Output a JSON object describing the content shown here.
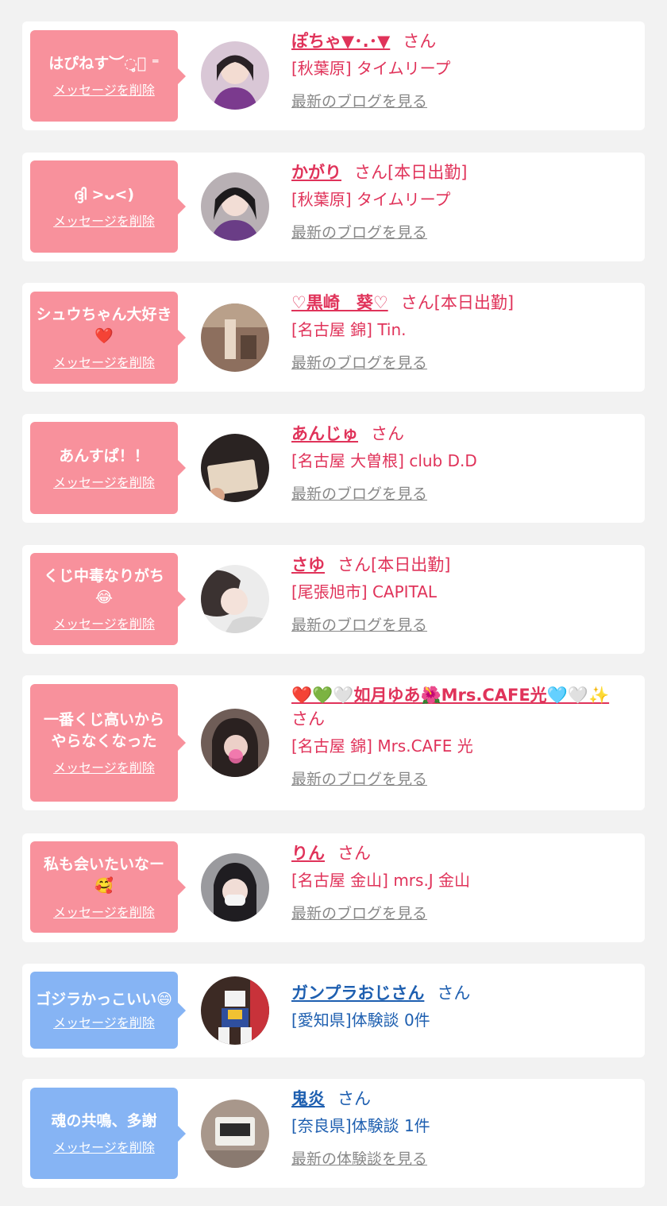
{
  "items": [
    {
      "message": "はぴねす︶◌̥̥̥⃝ ⁼",
      "delete_label": "メッセージを削除",
      "name": "ぽちゃ▼･.･▼",
      "san": "さん",
      "shop": "[秋葉原] タイムリープ",
      "latest": "最新のブログを見る",
      "theme": "pink"
    },
    {
      "message": "ദ്ദി >ᴗ<)",
      "delete_label": "メッセージを削除",
      "name": "かがり",
      "san": "さん[本日出勤]",
      "shop": "[秋葉原] タイムリープ",
      "latest": "最新のブログを見る",
      "theme": "pink"
    },
    {
      "message": "シュウちゃん大好き❤️",
      "delete_label": "メッセージを削除",
      "name": "♡黒崎　葵♡",
      "san": "さん[本日出勤]",
      "shop": "[名古屋 錦] Tin.",
      "latest": "最新のブログを見る",
      "theme": "pink"
    },
    {
      "message": "あんすぱ！！",
      "delete_label": "メッセージを削除",
      "name": "あんじゅ",
      "san": "さん",
      "shop": "[名古屋 大曽根] club D.D",
      "latest": "最新のブログを見る",
      "theme": "pink"
    },
    {
      "message": "くじ中毒なりがち😂",
      "delete_label": "メッセージを削除",
      "name": "さゆ",
      "san": "さん[本日出勤]",
      "shop": "[尾張旭市] CAPITAL",
      "latest": "最新のブログを見る",
      "theme": "pink"
    },
    {
      "message": "一番くじ高いからやらなくなった",
      "delete_label": "メッセージを削除",
      "name": "❤️💚🤍如月ゆあ🌺Mrs.CAFE光🩵🤍✨",
      "san": "さん",
      "shop": "[名古屋 錦] Mrs.CAFE 光",
      "latest": "最新のブログを見る",
      "theme": "pink"
    },
    {
      "message": "私も会いたいなー🥰",
      "delete_label": "メッセージを削除",
      "name": "りん",
      "san": "さん",
      "shop": "[名古屋 金山] mrs.J 金山",
      "latest": "最新のブログを見る",
      "theme": "pink"
    },
    {
      "message": "ゴジラかっこいい😄",
      "delete_label": "メッセージを削除",
      "name": "ガンプラおじさん",
      "san": "さん",
      "shop": "[愛知県]体験談 0件",
      "latest": "",
      "theme": "blue"
    },
    {
      "message": "魂の共鳴、多謝",
      "delete_label": "メッセージを削除",
      "name": "鬼炎",
      "san": "さん",
      "shop": "[奈良県]体験談 1件",
      "latest": "最新の体験談を見る",
      "theme": "blue"
    }
  ]
}
